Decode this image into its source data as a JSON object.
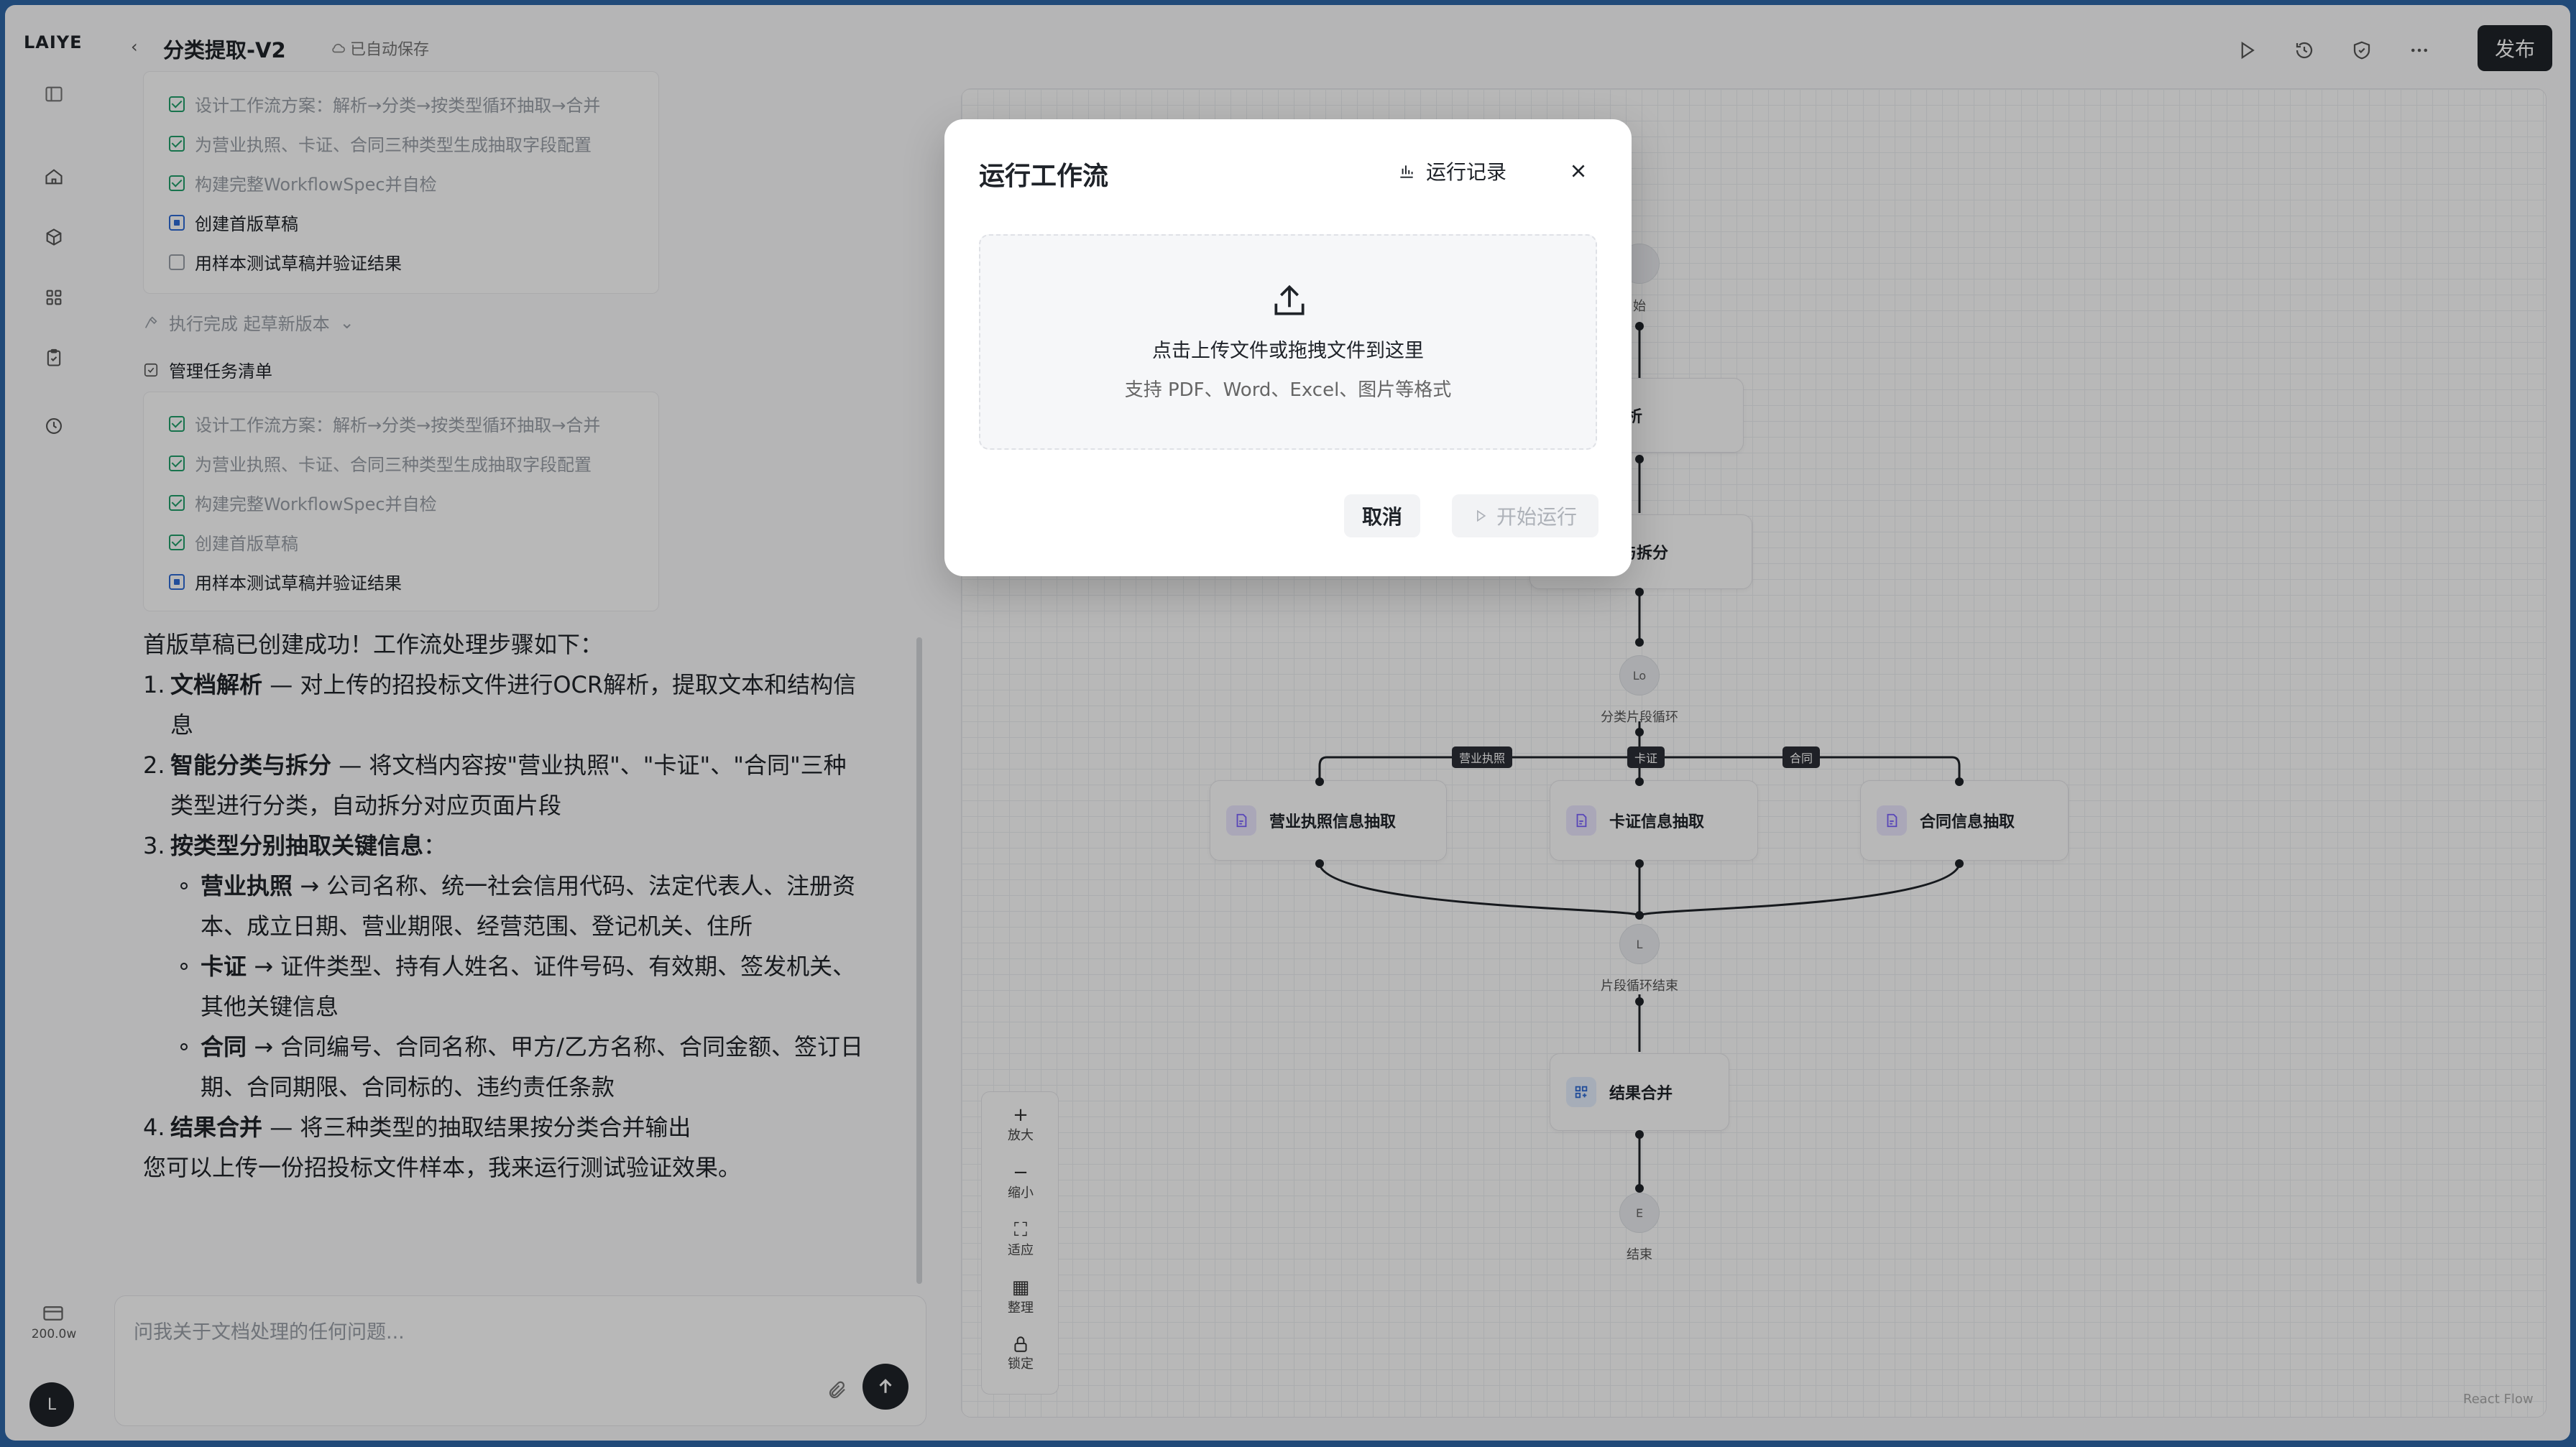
{
  "app": {
    "logo": "LAIYE",
    "quota": "200.0w",
    "avatar": "L"
  },
  "header": {
    "back": "‹",
    "title": "分类提取-V2",
    "saved": "已自动保存",
    "publish": "发布"
  },
  "chat": {
    "tasks_top": [
      {
        "label": "设计工作流方案：解析→分类→按类型循环抽取→合并",
        "state": "done"
      },
      {
        "label": "为营业执照、卡证、合同三种类型生成抽取字段配置",
        "state": "done"
      },
      {
        "label": "构建完整WorkflowSpec并自检",
        "state": "done"
      },
      {
        "label": "创建首版草稿",
        "state": "current"
      },
      {
        "label": "用样本测试草稿并验证结果",
        "state": "todo"
      }
    ],
    "exec_note": "执行完成 起草新版本",
    "manage_title": "管理任务清单",
    "tasks_bottom": [
      {
        "label": "设计工作流方案：解析→分类→按类型循环抽取→合并",
        "state": "done"
      },
      {
        "label": "为营业执照、卡证、合同三种类型生成抽取字段配置",
        "state": "done"
      },
      {
        "label": "构建完整WorkflowSpec并自检",
        "state": "done"
      },
      {
        "label": "创建首版草稿",
        "state": "done"
      },
      {
        "label": "用样本测试草稿并验证结果",
        "state": "current"
      }
    ],
    "intro": "首版草稿已创建成功！工作流处理步骤如下：",
    "steps": [
      {
        "num": "1.",
        "title": "文档解析",
        "text": " — 对上传的招投标文件进行OCR解析，提取文本和结构信息"
      },
      {
        "num": "2.",
        "title": "智能分类与拆分",
        "text": " — 将文档内容按\"营业执照\"、\"卡证\"、\"合同\"三种类型进行分类，自动拆分对应页面片段"
      },
      {
        "num": "3.",
        "title": "按类型分别抽取关键信息",
        "text": "："
      }
    ],
    "subs": [
      {
        "title": "营业执照",
        "text": " → 公司名称、统一社会信用代码、法定代表人、注册资本、成立日期、营业期限、经营范围、登记机关、住所"
      },
      {
        "title": "卡证",
        "text": " → 证件类型、持有人姓名、证件号码、有效期、签发机关、其他关键信息"
      },
      {
        "title": "合同",
        "text": " → 合同编号、合同名称、甲方/乙方名称、合同金额、签订日期、合同期限、合同标的、违约责任条款"
      }
    ],
    "step4": {
      "num": "4.",
      "title": "结果合并",
      "text": " — 将三种类型的抽取结果按分类合并输出"
    },
    "outro": "您可以上传一份招投标文件样本，我来运行测试验证效果。",
    "input_placeholder": "问我关于文档处理的任何问题..."
  },
  "workflow": {
    "nodes": {
      "start": "始",
      "parse": "档解析",
      "classify": "分类与拆分",
      "loop": "分类片段循环",
      "license": "营业执照信息抽取",
      "card": "卡证信息抽取",
      "contract": "合同信息抽取",
      "loop_end": "片段循环结束",
      "merge": "结果合并",
      "end": "结束"
    },
    "branch_tags": [
      "营业执照",
      "卡证",
      "合同"
    ],
    "zoom": {
      "in": "放大",
      "out": "缩小",
      "fit": "适应",
      "arrange": "整理",
      "lock": "锁定"
    },
    "attribution": "React Flow"
  },
  "modal": {
    "title": "运行工作流",
    "records": "运行记录",
    "upload_main": "点击上传文件或拖拽文件到这里",
    "upload_sub": "支持 PDF、Word、Excel、图片等格式",
    "cancel": "取消",
    "start": "开始运行"
  }
}
